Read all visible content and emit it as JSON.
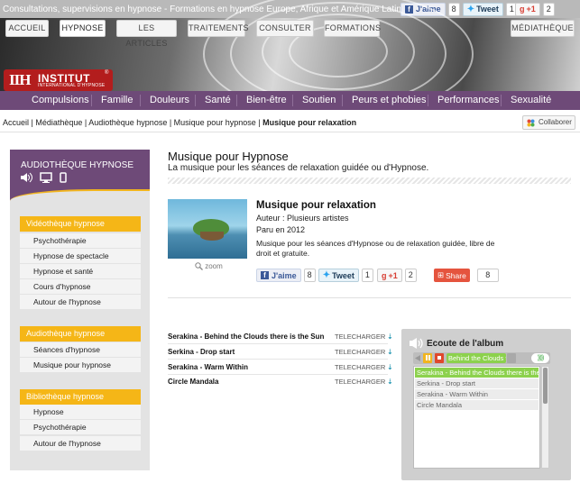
{
  "header": {
    "tagline": "Consultations, supervisions en hypnose - Formations en hypnose Europe, Afrique et Amérique Latine",
    "social": {
      "fb_label": "J'aime",
      "fb_count": "8",
      "tw_label": "Tweet",
      "tw_count": "1",
      "gp_label": "+1",
      "gp_count": "2"
    }
  },
  "nav": {
    "tabs": [
      "ACCUEIL",
      "HYPNOSE",
      "LES ARTICLES",
      "TRAITEMENTS",
      "CONSULTER",
      "FORMATIONS"
    ],
    "mediatheque": "MÉDIATHÈQUE",
    "active": "HYPNOSE"
  },
  "logo": {
    "mark": "IIH",
    "name": "INSTITUT",
    "subtitle": "INTERNATIONAL D'HYPNOSE",
    "reg": "®"
  },
  "categories": [
    "Compulsions",
    "Famille",
    "Douleurs",
    "Santé",
    "Bien-être",
    "Soutien",
    "Peurs et phobies",
    "Performances",
    "Sexualité"
  ],
  "breadcrumb": {
    "items": [
      "Accueil",
      "Médiathèque",
      "Audiothèque hypnose",
      "Musique pour hypnose"
    ],
    "current": "Musique pour relaxation",
    "sep": " | "
  },
  "collaborer": "Collaborer",
  "sidebar": {
    "title": "AUDIOTHÈQUE HYPNOSE",
    "sections": [
      {
        "title": "Vidéothèque hypnose",
        "items": [
          "Psychothérapie",
          "Hypnose de spectacle",
          "Hypnose et santé",
          "Cours d'hypnose",
          "Autour de l'hypnose"
        ]
      },
      {
        "title": "Audiothèque hypnose",
        "items": [
          "Séances d'hypnose",
          "Musique pour hypnose"
        ]
      },
      {
        "title": "Bibliothèque hypnose",
        "items": [
          "Hypnose",
          "Psychothérapie",
          "Autour de l'hypnose"
        ]
      }
    ]
  },
  "main": {
    "title": "Musique pour Hypnose",
    "subtitle": "La musique pour les séances de relaxation guidée ou d'Hypnose.",
    "album": {
      "title": "Musique pour relaxation",
      "author": "Auteur : Plusieurs artistes",
      "year": "Paru en 2012",
      "description": "Musique pour les séances d'Hypnose ou de relaxation guidée, libre de droit et gratuite.",
      "zoom": "zoom"
    },
    "share": {
      "fb_label": "J'aime",
      "fb_count": "8",
      "tw_label": "Tweet",
      "tw_count": "1",
      "gp_label": "+1",
      "gp_count": "2",
      "share_label": "Share",
      "share_count": "8"
    },
    "tracks": [
      {
        "name": "Serakina - Behind the Clouds there is the Sun",
        "action": "TELECHARGER"
      },
      {
        "name": "Serkina - Drop start",
        "action": "TELECHARGER"
      },
      {
        "name": "Serakina - Warm Within",
        "action": "TELECHARGER"
      },
      {
        "name": "Circle Mandala",
        "action": "TELECHARGER"
      }
    ]
  },
  "player": {
    "title": "Ecoute de l'album",
    "now_playing": "Behind the Clouds th",
    "playlist": [
      "Serakina - Behind the Clouds there is the",
      "Serkina - Drop start",
      "Serakina - Warm Within",
      "Circle Mandala"
    ]
  },
  "colors": {
    "purple": "#6e4a78",
    "orange": "#f5b617",
    "red": "#b31d1d",
    "green": "#8cd14d"
  }
}
